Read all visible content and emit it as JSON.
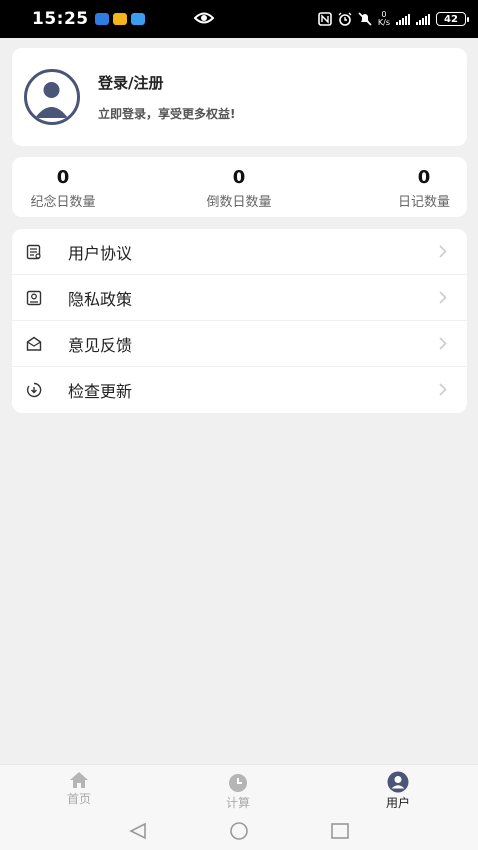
{
  "status_bar": {
    "time": "15:25",
    "net_speed_value": "0",
    "net_speed_unit": "K/s",
    "battery": "42"
  },
  "profile": {
    "title": "登录/注册",
    "subtitle": "立即登录，享受更多权益!"
  },
  "stats": [
    {
      "value": "0",
      "label": "纪念日数量"
    },
    {
      "value": "0",
      "label": "倒数日数量"
    },
    {
      "value": "0",
      "label": "日记数量"
    }
  ],
  "menu": [
    {
      "label": "用户协议",
      "icon": "document-icon"
    },
    {
      "label": "隐私政策",
      "icon": "privacy-icon"
    },
    {
      "label": "意见反馈",
      "icon": "mail-icon"
    },
    {
      "label": "检查更新",
      "icon": "update-icon"
    }
  ],
  "tabs": [
    {
      "label": "首页",
      "icon": "home-icon"
    },
    {
      "label": "计算",
      "icon": "clock-icon"
    },
    {
      "label": "用户",
      "icon": "user-icon"
    }
  ],
  "colors": {
    "accent": "#4a5577",
    "background": "#f0f0f0",
    "inactive": "#aaaaaa"
  }
}
